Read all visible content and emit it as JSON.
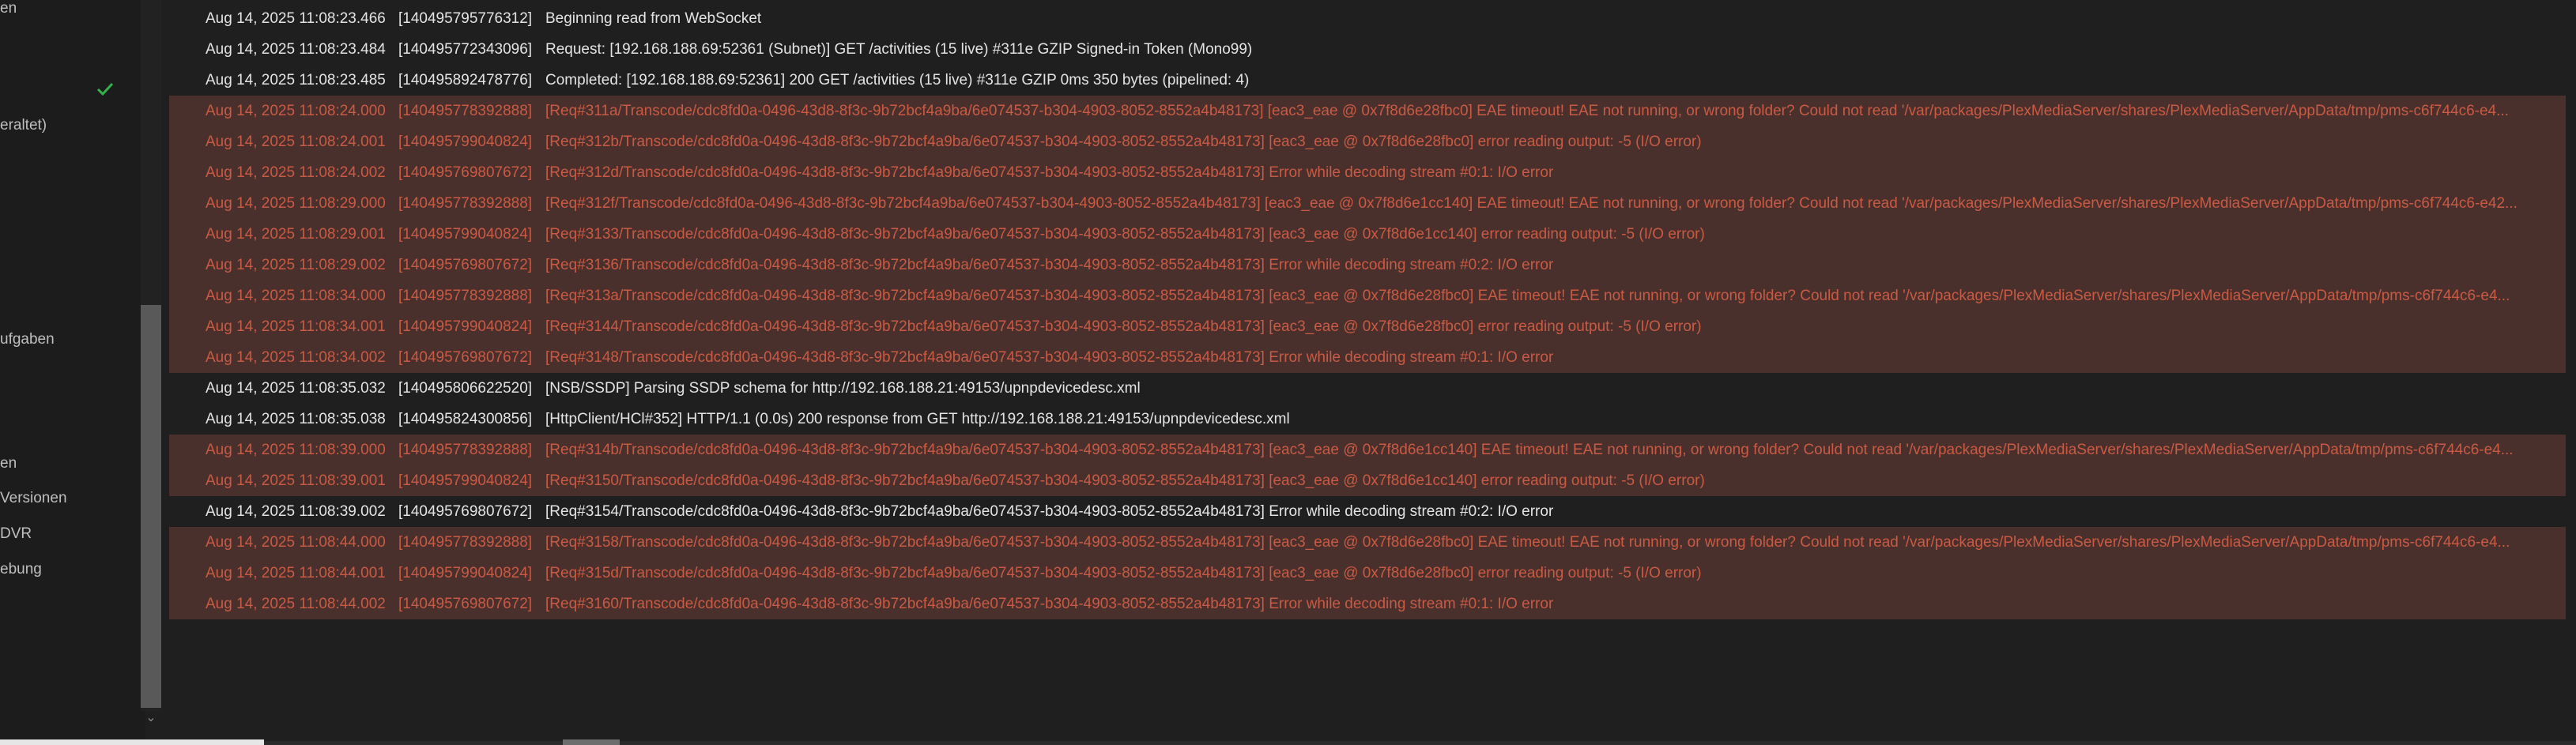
{
  "sidebar": {
    "items": [
      {
        "label": "en"
      },
      {
        "label": "eraltet)"
      },
      {
        "label": "ufgaben"
      },
      {
        "label": "en"
      },
      {
        "label": "Versionen"
      },
      {
        "label": "DVR"
      },
      {
        "label": "ebung"
      }
    ]
  },
  "log": {
    "rows": [
      {
        "ts": "Aug 14, 2025 11:08:23.466",
        "tid": "[140495795776312]",
        "msg": "Beginning read from WebSocket",
        "level": "normal"
      },
      {
        "ts": "Aug 14, 2025 11:08:23.484",
        "tid": "[140495772343096]",
        "msg": "Request: [192.168.188.69:52361 (Subnet)] GET /activities (15 live) #311e GZIP Signed-in Token (Mono99)",
        "level": "normal"
      },
      {
        "ts": "Aug 14, 2025 11:08:23.485",
        "tid": "[140495892478776]",
        "msg": "Completed: [192.168.188.69:52361] 200 GET /activities (15 live) #311e GZIP 0ms 350 bytes (pipelined: 4)",
        "level": "normal"
      },
      {
        "ts": "Aug 14, 2025 11:08:24.000",
        "tid": "[140495778392888]",
        "msg": "[Req#311a/Transcode/cdc8fd0a-0496-43d8-8f3c-9b72bcf4a9ba/6e074537-b304-4903-8052-8552a4b48173] [eac3_eae @ 0x7f8d6e28fbc0] EAE timeout! EAE not running, or wrong folder? Could not read '/var/packages/PlexMediaServer/shares/PlexMediaServer/AppData/tmp/pms-c6f744c6-e4...",
        "level": "error"
      },
      {
        "ts": "Aug 14, 2025 11:08:24.001",
        "tid": "[140495799040824]",
        "msg": "[Req#312b/Transcode/cdc8fd0a-0496-43d8-8f3c-9b72bcf4a9ba/6e074537-b304-4903-8052-8552a4b48173] [eac3_eae @ 0x7f8d6e28fbc0] error reading output: -5 (I/O error)",
        "level": "error"
      },
      {
        "ts": "Aug 14, 2025 11:08:24.002",
        "tid": "[140495769807672]",
        "msg": "[Req#312d/Transcode/cdc8fd0a-0496-43d8-8f3c-9b72bcf4a9ba/6e074537-b304-4903-8052-8552a4b48173] Error while decoding stream #0:1: I/O error",
        "level": "error"
      },
      {
        "ts": "Aug 14, 2025 11:08:29.000",
        "tid": "[140495778392888]",
        "msg": "[Req#312f/Transcode/cdc8fd0a-0496-43d8-8f3c-9b72bcf4a9ba/6e074537-b304-4903-8052-8552a4b48173] [eac3_eae @ 0x7f8d6e1cc140] EAE timeout! EAE not running, or wrong folder? Could not read '/var/packages/PlexMediaServer/shares/PlexMediaServer/AppData/tmp/pms-c6f744c6-e42...",
        "level": "error"
      },
      {
        "ts": "Aug 14, 2025 11:08:29.001",
        "tid": "[140495799040824]",
        "msg": "[Req#3133/Transcode/cdc8fd0a-0496-43d8-8f3c-9b72bcf4a9ba/6e074537-b304-4903-8052-8552a4b48173] [eac3_eae @ 0x7f8d6e1cc140] error reading output: -5 (I/O error)",
        "level": "error"
      },
      {
        "ts": "Aug 14, 2025 11:08:29.002",
        "tid": "[140495769807672]",
        "msg": "[Req#3136/Transcode/cdc8fd0a-0496-43d8-8f3c-9b72bcf4a9ba/6e074537-b304-4903-8052-8552a4b48173] Error while decoding stream #0:2: I/O error",
        "level": "error"
      },
      {
        "ts": "Aug 14, 2025 11:08:34.000",
        "tid": "[140495778392888]",
        "msg": "[Req#313a/Transcode/cdc8fd0a-0496-43d8-8f3c-9b72bcf4a9ba/6e074537-b304-4903-8052-8552a4b48173] [eac3_eae @ 0x7f8d6e28fbc0] EAE timeout! EAE not running, or wrong folder? Could not read '/var/packages/PlexMediaServer/shares/PlexMediaServer/AppData/tmp/pms-c6f744c6-e4...",
        "level": "error"
      },
      {
        "ts": "Aug 14, 2025 11:08:34.001",
        "tid": "[140495799040824]",
        "msg": "[Req#3144/Transcode/cdc8fd0a-0496-43d8-8f3c-9b72bcf4a9ba/6e074537-b304-4903-8052-8552a4b48173] [eac3_eae @ 0x7f8d6e28fbc0] error reading output: -5 (I/O error)",
        "level": "error"
      },
      {
        "ts": "Aug 14, 2025 11:08:34.002",
        "tid": "[140495769807672]",
        "msg": "[Req#3148/Transcode/cdc8fd0a-0496-43d8-8f3c-9b72bcf4a9ba/6e074537-b304-4903-8052-8552a4b48173] Error while decoding stream #0:1: I/O error",
        "level": "error"
      },
      {
        "ts": "Aug 14, 2025 11:08:35.032",
        "tid": "[140495806622520]",
        "msg": "[NSB/SSDP] Parsing SSDP schema for http://192.168.188.21:49153/upnpdevicedesc.xml",
        "level": "normal"
      },
      {
        "ts": "Aug 14, 2025 11:08:35.038",
        "tid": "[140495824300856]",
        "msg": "[HttpClient/HCl#352] HTTP/1.1 (0.0s) 200 response from GET http://192.168.188.21:49153/upnpdevicedesc.xml",
        "level": "normal"
      },
      {
        "ts": "Aug 14, 2025 11:08:39.000",
        "tid": "[140495778392888]",
        "msg": "[Req#314b/Transcode/cdc8fd0a-0496-43d8-8f3c-9b72bcf4a9ba/6e074537-b304-4903-8052-8552a4b48173] [eac3_eae @ 0x7f8d6e1cc140] EAE timeout! EAE not running, or wrong folder? Could not read '/var/packages/PlexMediaServer/shares/PlexMediaServer/AppData/tmp/pms-c6f744c6-e4...",
        "level": "error"
      },
      {
        "ts": "Aug 14, 2025 11:08:39.001",
        "tid": "[140495799040824]",
        "msg": "[Req#3150/Transcode/cdc8fd0a-0496-43d8-8f3c-9b72bcf4a9ba/6e074537-b304-4903-8052-8552a4b48173] [eac3_eae @ 0x7f8d6e1cc140] error reading output: -5 (I/O error)",
        "level": "error"
      },
      {
        "ts": "Aug 14, 2025 11:08:39.002",
        "tid": "[140495769807672]",
        "msg": "[Req#3154/Transcode/cdc8fd0a-0496-43d8-8f3c-9b72bcf4a9ba/6e074537-b304-4903-8052-8552a4b48173] Error while decoding stream #0:2: I/O error",
        "level": "normal"
      },
      {
        "ts": "Aug 14, 2025 11:08:44.000",
        "tid": "[140495778392888]",
        "msg": "[Req#3158/Transcode/cdc8fd0a-0496-43d8-8f3c-9b72bcf4a9ba/6e074537-b304-4903-8052-8552a4b48173] [eac3_eae @ 0x7f8d6e28fbc0] EAE timeout! EAE not running, or wrong folder? Could not read '/var/packages/PlexMediaServer/shares/PlexMediaServer/AppData/tmp/pms-c6f744c6-e4...",
        "level": "error"
      },
      {
        "ts": "Aug 14, 2025 11:08:44.001",
        "tid": "[140495799040824]",
        "msg": "[Req#315d/Transcode/cdc8fd0a-0496-43d8-8f3c-9b72bcf4a9ba/6e074537-b304-4903-8052-8552a4b48173] [eac3_eae @ 0x7f8d6e28fbc0] error reading output: -5 (I/O error)",
        "level": "error"
      },
      {
        "ts": "Aug 14, 2025 11:08:44.002",
        "tid": "[140495769807672]",
        "msg": "[Req#3160/Transcode/cdc8fd0a-0496-43d8-8f3c-9b72bcf4a9ba/6e074537-b304-4903-8052-8552a4b48173] Error while decoding stream #0:1: I/O error",
        "level": "error"
      }
    ]
  },
  "colors": {
    "error_bg": "#4a302c",
    "error_text": "#c95a44",
    "check": "#35b24a"
  }
}
